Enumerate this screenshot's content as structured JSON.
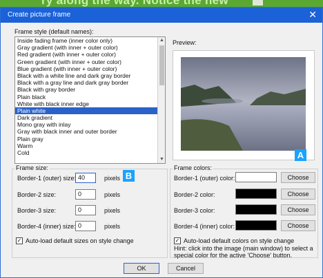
{
  "banner": {
    "text": "ry along the way. Notice the new"
  },
  "dialog": {
    "title": "Create picture frame",
    "frame_style_label": "Frame style (default names):",
    "styles": [
      "Inside fading frame (inner color only)",
      "Gray gradient (with inner + outer color)",
      "Red gradient (with inner + outer color)",
      "Green gradient (with inner + outer color)",
      "Blue gradient (with inner + outer color)",
      "Black with a white line and dark gray border",
      "Black with a gray line and dark gray border",
      "Black with gray border",
      "Plain black",
      "White with black inner edge",
      "Plain white",
      "Dark gradient",
      "Mono gray with inlay",
      "Gray with black inner and outer border",
      "Plain gray",
      "Warm",
      "Cold"
    ],
    "selected_style_index": 10,
    "preview_label": "Preview:",
    "frame_size": {
      "label": "Frame size:",
      "rows": [
        {
          "label": "Border-1 (outer) size:",
          "value": "40",
          "unit": "pixels"
        },
        {
          "label": "Border-2 size:",
          "value": "0",
          "unit": "pixels"
        },
        {
          "label": "Border-3 size:",
          "value": "0",
          "unit": "pixels"
        },
        {
          "label": "Border-4 (inner) size:",
          "value": "0",
          "unit": "pixels"
        }
      ],
      "autoload_label": "Auto-load default sizes on style change",
      "autoload_checked": true
    },
    "frame_colors": {
      "label": "Frame colors:",
      "rows": [
        {
          "label": "Border-1 (outer) color:",
          "color": "#ffffff",
          "button": "Choose"
        },
        {
          "label": "Border-2 color:",
          "color": "#000000",
          "button": "Choose"
        },
        {
          "label": "Border-3 color:",
          "color": "#000000",
          "button": "Choose"
        },
        {
          "label": "Border-4 (inner) color:",
          "color": "#000000",
          "button": "Choose"
        }
      ],
      "autoload_label": "Auto-load default colors on style change",
      "autoload_checked": true,
      "hint": "Hint: click into the image (main window) to select a special color for the active 'Choose' button."
    },
    "ok_label": "OK",
    "cancel_label": "Cancel"
  },
  "annotations": {
    "a": "A",
    "b": "B"
  },
  "colors": {
    "titlebar": "#1b62d9",
    "selection": "#2a62c9",
    "badge": "#1aa3ff",
    "dot": "#e0141e"
  }
}
